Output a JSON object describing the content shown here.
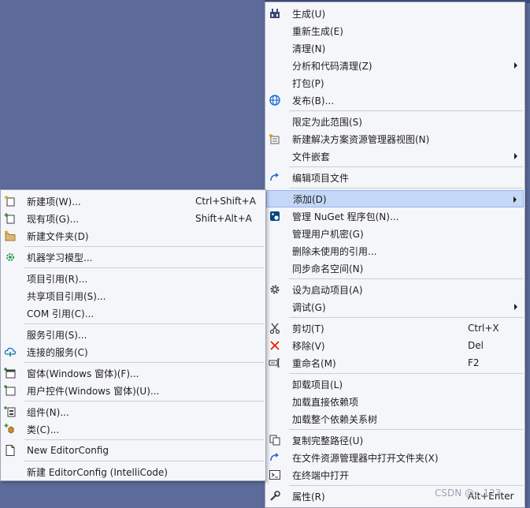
{
  "main_menu": {
    "items": [
      {
        "label": "生成(U)",
        "icon": "build-icon"
      },
      {
        "label": "重新生成(E)"
      },
      {
        "label": "清理(N)"
      },
      {
        "label": "分析和代码清理(Z)"
      },
      {
        "label": "打包(P)"
      },
      {
        "label": "发布(B)...",
        "icon": "publish-globe-icon"
      },
      {
        "label": "限定为此范围(S)"
      },
      {
        "label": "新建解决方案资源管理器视图(N)",
        "icon": "new-view-icon"
      },
      {
        "label": "文件嵌套"
      },
      {
        "label": "编辑项目文件",
        "icon": "redo-arrow-icon"
      },
      {
        "label": "添加(D)"
      },
      {
        "label": "管理 NuGet 程序包(N)...",
        "icon": "nuget-icon"
      },
      {
        "label": "管理用户机密(G)"
      },
      {
        "label": "删除未使用的引用..."
      },
      {
        "label": "同步命名空间(N)"
      },
      {
        "label": "设为启动项目(A)",
        "icon": "gear-icon"
      },
      {
        "label": "调试(G)"
      },
      {
        "label": "剪切(T)",
        "shortcut": "Ctrl+X",
        "icon": "scissors-icon"
      },
      {
        "label": "移除(V)",
        "shortcut": "Del",
        "icon": "remove-x-icon"
      },
      {
        "label": "重命名(M)",
        "shortcut": "F2",
        "icon": "rename-icon"
      },
      {
        "label": "卸载项目(L)"
      },
      {
        "label": "加载直接依赖项"
      },
      {
        "label": "加载整个依赖关系树"
      },
      {
        "label": "复制完整路径(U)",
        "icon": "copy-icon"
      },
      {
        "label": "在文件资源管理器中打开文件夹(X)",
        "icon": "open-folder-arrow-icon"
      },
      {
        "label": "在终端中打开",
        "icon": "terminal-icon"
      },
      {
        "label": "属性(R)",
        "shortcut": "Alt+Enter",
        "icon": "wrench-icon"
      }
    ]
  },
  "sub_menu": {
    "items": [
      {
        "label": "新建项(W)...",
        "shortcut": "Ctrl+Shift+A",
        "icon": "new-item-icon"
      },
      {
        "label": "现有项(G)...",
        "shortcut": "Shift+Alt+A",
        "icon": "existing-item-icon"
      },
      {
        "label": "新建文件夹(D)",
        "icon": "new-folder-icon"
      },
      {
        "label": "机器学习模型...",
        "icon": "ml-model-icon"
      },
      {
        "label": "项目引用(R)..."
      },
      {
        "label": "共享项目引用(S)..."
      },
      {
        "label": "COM 引用(C)..."
      },
      {
        "label": "服务引用(S)..."
      },
      {
        "label": "连接的服务(C)",
        "icon": "connected-service-icon"
      },
      {
        "label": "窗体(Windows 窗体)(F)...",
        "icon": "windows-form-icon"
      },
      {
        "label": "用户控件(Windows 窗体)(U)...",
        "icon": "user-control-icon"
      },
      {
        "label": "组件(N)...",
        "icon": "component-icon"
      },
      {
        "label": "类(C)...",
        "icon": "class-icon"
      },
      {
        "label": "New EditorConfig",
        "icon": "editorconfig-file-icon"
      },
      {
        "label": "新建 EditorConfig (IntelliCode)"
      }
    ]
  },
  "watermark": "CSDN @...123"
}
